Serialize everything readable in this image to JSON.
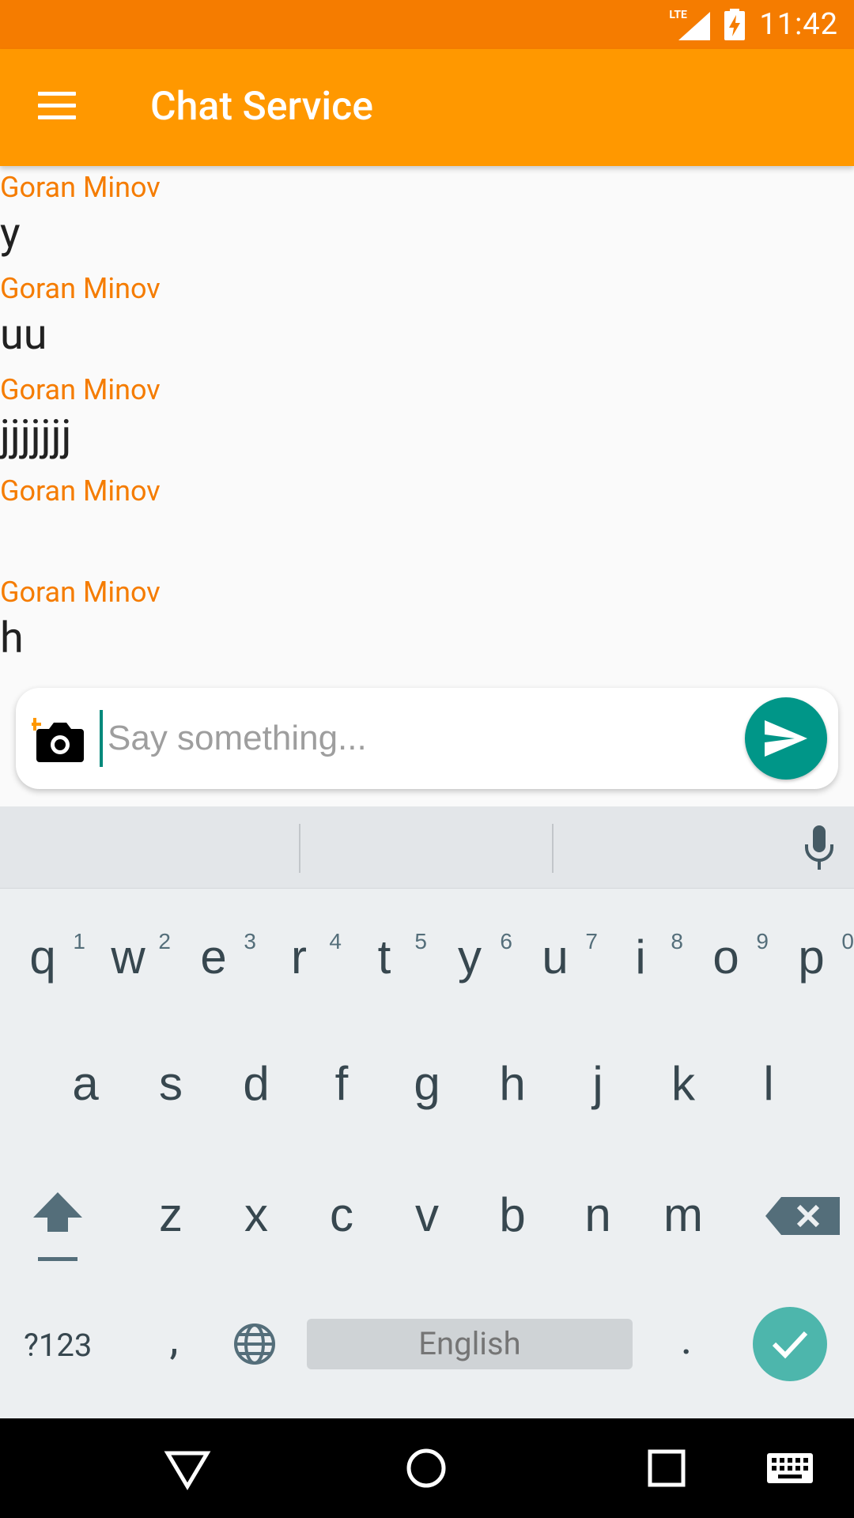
{
  "status_bar": {
    "network": "LTE",
    "time": "11:42"
  },
  "app_bar": {
    "title": "Chat Service"
  },
  "messages": [
    {
      "author": "Goran Minov",
      "text": "y"
    },
    {
      "author": "Goran Minov",
      "text": "uu"
    },
    {
      "author": "Goran Minov",
      "text": "jjjjjjj"
    },
    {
      "author": "Goran Minov",
      "text": ""
    },
    {
      "author": "Goran Minov",
      "text": "h"
    }
  ],
  "composer": {
    "placeholder": "Say something...",
    "value": ""
  },
  "keyboard": {
    "row1": [
      {
        "key": "q",
        "hint": "1"
      },
      {
        "key": "w",
        "hint": "2"
      },
      {
        "key": "e",
        "hint": "3"
      },
      {
        "key": "r",
        "hint": "4"
      },
      {
        "key": "t",
        "hint": "5"
      },
      {
        "key": "y",
        "hint": "6"
      },
      {
        "key": "u",
        "hint": "7"
      },
      {
        "key": "i",
        "hint": "8"
      },
      {
        "key": "o",
        "hint": "9"
      },
      {
        "key": "p",
        "hint": "0"
      }
    ],
    "row2": [
      "a",
      "s",
      "d",
      "f",
      "g",
      "h",
      "j",
      "k",
      "l"
    ],
    "row3": [
      "z",
      "x",
      "c",
      "v",
      "b",
      "n",
      "m"
    ],
    "symbols_label": "?123",
    "comma": ",",
    "space_label": "English",
    "period": "."
  },
  "colors": {
    "status_bar": "#f57c00",
    "app_bar": "#ff9800",
    "author": "#f57c00",
    "send_button": "#009688",
    "done_key": "#4db6ac"
  },
  "icons": {
    "menu": "menu-icon",
    "camera": "add-photo-icon",
    "send": "send-icon",
    "mic": "mic-icon",
    "shift": "shift-icon",
    "backspace": "backspace-icon",
    "globe": "globe-icon",
    "done": "check-icon",
    "nav_back": "back-triangle-icon",
    "nav_home": "home-circle-icon",
    "nav_recents": "recents-square-icon",
    "nav_keyboard": "keyboard-icon"
  }
}
